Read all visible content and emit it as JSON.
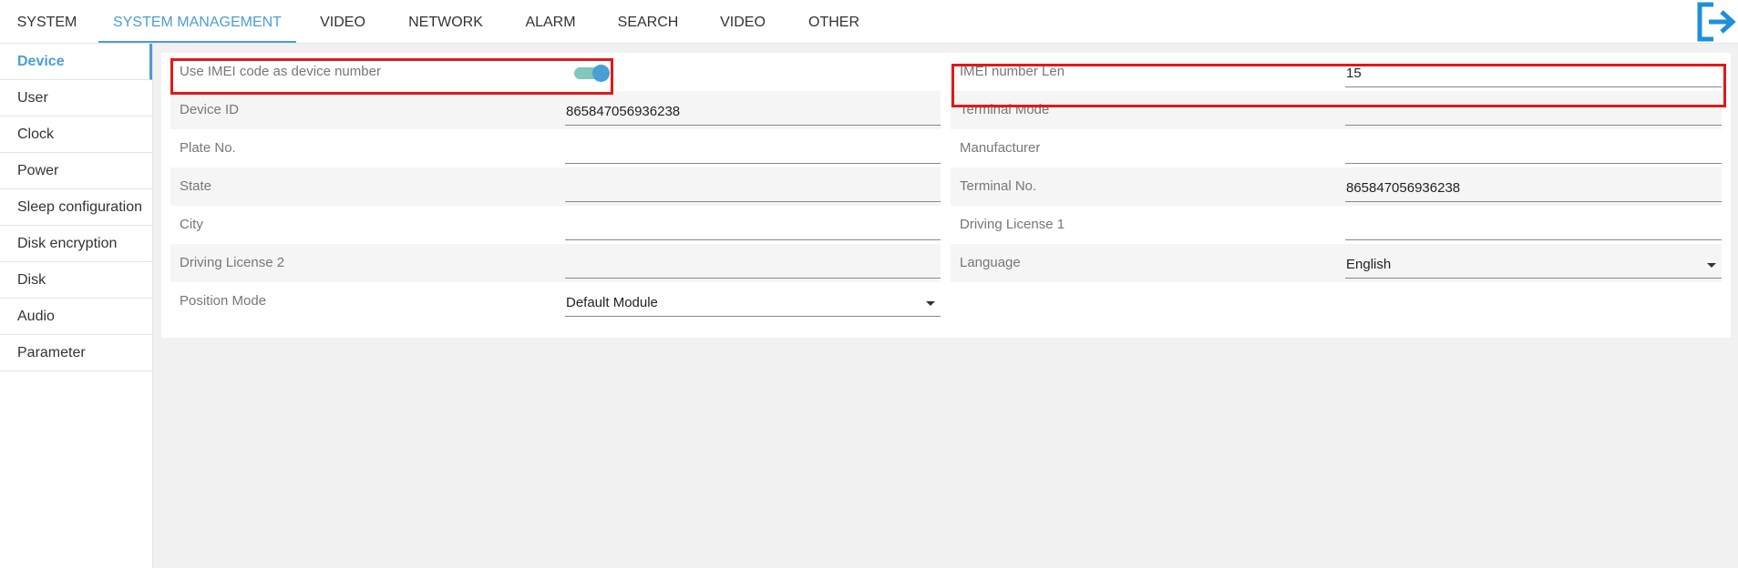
{
  "topnav": {
    "tabs": [
      {
        "label": "SYSTEM",
        "active": false
      },
      {
        "label": "SYSTEM MANAGEMENT",
        "active": true
      },
      {
        "label": "VIDEO",
        "active": false
      },
      {
        "label": "NETWORK",
        "active": false
      },
      {
        "label": "ALARM",
        "active": false
      },
      {
        "label": "SEARCH",
        "active": false
      },
      {
        "label": "VIDEO",
        "active": false
      },
      {
        "label": "OTHER",
        "active": false
      }
    ],
    "logout_icon": "logout-icon"
  },
  "sidebar": {
    "items": [
      {
        "label": "Device",
        "active": true
      },
      {
        "label": "User"
      },
      {
        "label": "Clock"
      },
      {
        "label": "Power"
      },
      {
        "label": "Sleep configuration"
      },
      {
        "label": "Disk encryption"
      },
      {
        "label": "Disk"
      },
      {
        "label": "Audio"
      },
      {
        "label": "Parameter"
      }
    ]
  },
  "form": {
    "use_imei": {
      "label": "Use IMEI code as device number",
      "enabled": true
    },
    "imei_len": {
      "label": "IMEI number Len",
      "value": "15"
    },
    "device_id": {
      "label": "Device ID",
      "value": "865847056936238"
    },
    "terminal_mode": {
      "label": "Terminal Mode",
      "value": ""
    },
    "plate_no": {
      "label": "Plate No.",
      "value": ""
    },
    "manufacturer": {
      "label": "Manufacturer",
      "value": ""
    },
    "state": {
      "label": "State",
      "value": ""
    },
    "terminal_no": {
      "label": "Terminal No.",
      "value": "865847056936238"
    },
    "city": {
      "label": "City",
      "value": ""
    },
    "driving_license_1": {
      "label": "Driving License 1",
      "value": ""
    },
    "driving_license_2": {
      "label": "Driving License 2",
      "value": ""
    },
    "language": {
      "label": "Language",
      "value": "English"
    },
    "position_mode": {
      "label": "Position Mode",
      "value": "Default Module"
    }
  },
  "colors": {
    "accent": "#4a9ed6",
    "highlight_box": "#e11919",
    "toggle_track": "#82c6bd"
  }
}
